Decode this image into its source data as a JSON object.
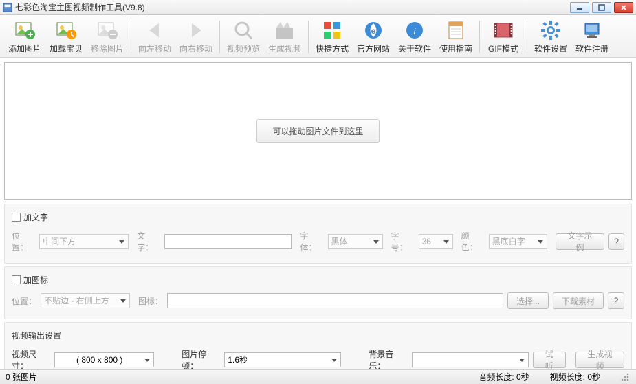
{
  "window": {
    "title": "七彩色淘宝主图视频制作工具(V9.8)"
  },
  "toolbar": [
    {
      "id": "add-image",
      "label": "添加图片",
      "enabled": true
    },
    {
      "id": "load-item",
      "label": "加载宝贝",
      "enabled": true
    },
    {
      "id": "remove-image",
      "label": "移除图片",
      "enabled": false
    },
    {
      "sep": true
    },
    {
      "id": "move-left",
      "label": "向左移动",
      "enabled": false
    },
    {
      "id": "move-right",
      "label": "向右移动",
      "enabled": false
    },
    {
      "sep": true
    },
    {
      "id": "preview-video",
      "label": "视频预览",
      "enabled": false
    },
    {
      "id": "make-video",
      "label": "生成视频",
      "enabled": false
    },
    {
      "sep": true
    },
    {
      "id": "shortcut",
      "label": "快捷方式",
      "enabled": true
    },
    {
      "id": "website",
      "label": "官方网站",
      "enabled": true
    },
    {
      "id": "about",
      "label": "关于软件",
      "enabled": true
    },
    {
      "id": "guide",
      "label": "使用指南",
      "enabled": true
    },
    {
      "sep": true
    },
    {
      "id": "gif-mode",
      "label": "GIF模式",
      "enabled": true
    },
    {
      "sep": true
    },
    {
      "id": "settings",
      "label": "软件设置",
      "enabled": true
    },
    {
      "id": "register",
      "label": "软件注册",
      "enabled": true
    }
  ],
  "canvas": {
    "drop_hint": "可以拖动图片文件到这里"
  },
  "text_section": {
    "checkbox_label": "加文字",
    "pos_label": "位置：",
    "pos_value": "中间下方",
    "text_label": "文字：",
    "text_value": "",
    "font_label": "字体：",
    "font_value": "黑体",
    "size_label": "字号：",
    "size_value": "36",
    "color_label": "颜色：",
    "color_value": "黑底白字",
    "sample_btn": "文字示例",
    "help": "?"
  },
  "icon_section": {
    "checkbox_label": "加图标",
    "pos_label": "位置：",
    "pos_value": "不贴边 - 右侧上方",
    "icon_label": "图标：",
    "icon_value": "",
    "choose_btn": "选择...",
    "download_btn": "下载素材",
    "help": "?"
  },
  "output_section": {
    "header": "视频输出设置",
    "size_label": "视频尺寸：",
    "size_value": "( 800 x 800 )",
    "pause_label": "图片停顿：",
    "pause_value": "1.6秒",
    "music_label": "背景音乐：",
    "music_value": "",
    "listen_btn": "试听",
    "make_btn": "生成视频"
  },
  "status": {
    "count": "0 张图片",
    "audio": "音频长度: 0秒",
    "video": "视频长度: 0秒"
  }
}
